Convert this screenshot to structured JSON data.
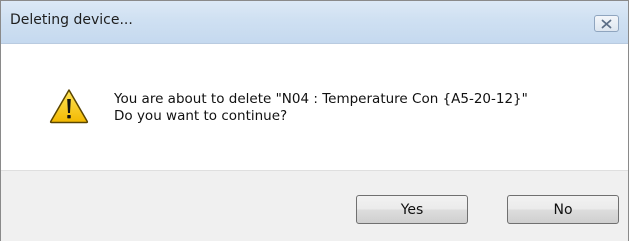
{
  "window": {
    "title": "Deleting device...",
    "close_icon": "close-x-icon"
  },
  "message": {
    "icon": "warning-icon",
    "line1": "You are about to delete \"N04 : Temperature Con {A5-20-12}\"",
    "line2": "Do you want to continue?"
  },
  "buttons": {
    "yes_label": "Yes",
    "no_label": "No"
  },
  "colors": {
    "warning_fill": "#f5c400",
    "warning_border": "#4a3a00",
    "titlebar": "#cfe0f2",
    "footer": "#f0f0f0"
  }
}
